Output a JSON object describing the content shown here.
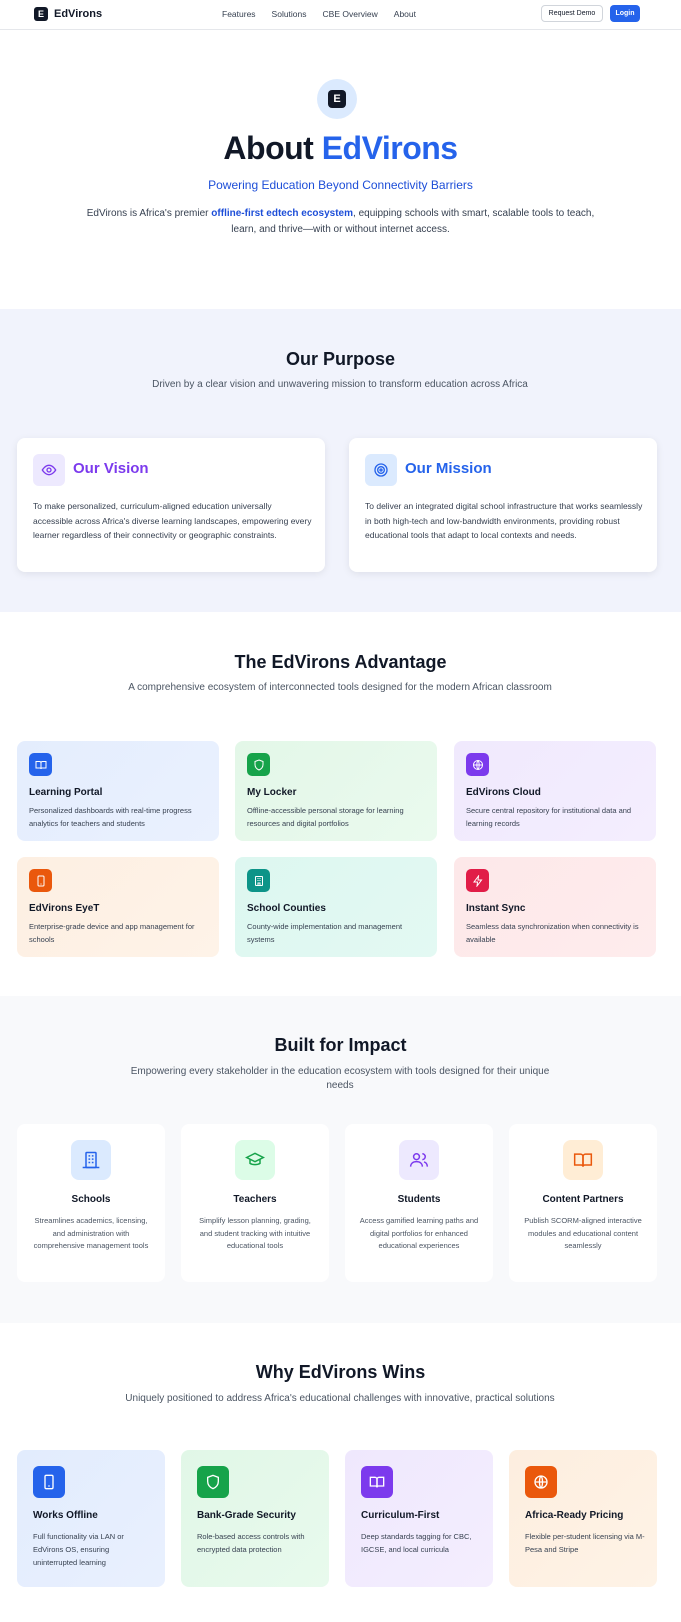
{
  "nav": {
    "brand": "EdVirons",
    "brand_logo_letter": "E",
    "links": [
      "Features",
      "Solutions",
      "CBE Overview",
      "About"
    ],
    "request_demo": "Request Demo",
    "login": "Login",
    "accent_color": "#2563eb"
  },
  "hero": {
    "logo_letter": "E",
    "title_prefix": "About",
    "title_accent": "EdVirons",
    "subtitle": "Powering Education Beyond Connectivity Barriers",
    "desc_before": "EdVirons is Africa's premier",
    "desc_highlight": "offline-first edtech ecosystem",
    "desc_after": ", equipping schools with smart, scalable tools to teach, learn, and thrive—with or without internet access."
  },
  "purpose": {
    "title": "Our Purpose",
    "subtitle": "Driven by a clear vision and unwavering mission to transform education across Africa",
    "vision": {
      "icon": "eye-icon",
      "title": "Our Vision",
      "text": "To make personalized, curriculum-aligned education universally accessible across Africa's diverse learning landscapes, empowering every learner regardless of their connectivity or geographic constraints.",
      "color": "#7c3aed"
    },
    "mission": {
      "icon": "target-icon",
      "title": "Our Mission",
      "text": "To deliver an integrated digital school infrastructure that works seamlessly in both high-tech and low-bandwidth environments, providing robust educational tools that adapt to local contexts and needs.",
      "color": "#2563eb"
    }
  },
  "advantage": {
    "title": "The EdVirons Advantage",
    "subtitle": "A comprehensive ecosystem of interconnected tools designed for the modern African classroom",
    "items": [
      {
        "icon": "book-icon",
        "title": "Learning Portal",
        "text": "Personalized dashboards with real-time progress analytics for teachers and students",
        "color": "#2563eb",
        "bg": "#e6effd"
      },
      {
        "icon": "shield-icon",
        "title": "My Locker",
        "text": "Offline-accessible personal storage for learning resources and digital portfolios",
        "color": "#16a34a",
        "bg": "#e5f8ea"
      },
      {
        "icon": "globe-icon",
        "title": "EdVirons Cloud",
        "text": "Secure central repository for institutional data and learning records",
        "color": "#7c3aed",
        "bg": "#f2ebfd"
      },
      {
        "icon": "tablet-icon",
        "title": "EdVirons EyeT",
        "text": "Enterprise-grade device and app management for schools",
        "color": "#ea580c",
        "bg": "#fdf1e4"
      },
      {
        "icon": "building-icon",
        "title": "School Counties",
        "text": "County-wide implementation and management systems",
        "color": "#0d9488",
        "bg": "#dff8f1"
      },
      {
        "icon": "lightning-icon",
        "title": "Instant Sync",
        "text": "Seamless data synchronization when connectivity is available",
        "color": "#e11d48",
        "bg": "#fde9ea"
      }
    ]
  },
  "impact": {
    "title": "Built for Impact",
    "subtitle": "Empowering every stakeholder in the education ecosystem with tools designed for their unique needs",
    "items": [
      {
        "icon": "school-building-icon",
        "title": "Schools",
        "text": "Streamlines academics, licensing, and administration with comprehensive management tools",
        "color": "#2563eb",
        "bg": "#dbeafe"
      },
      {
        "icon": "graduation-cap-icon",
        "title": "Teachers",
        "text": "Simplify lesson planning, grading, and student tracking with intuitive educational tools",
        "color": "#16a34a",
        "bg": "#dcfce7"
      },
      {
        "icon": "users-icon",
        "title": "Students",
        "text": "Access gamified learning paths and digital portfolios for enhanced educational experiences",
        "color": "#7c3aed",
        "bg": "#ede9fe"
      },
      {
        "icon": "open-book-icon",
        "title": "Content Partners",
        "text": "Publish SCORM-aligned interactive modules and educational content seamlessly",
        "color": "#ea580c",
        "bg": "#ffedd5"
      }
    ]
  },
  "wins": {
    "title": "Why EdVirons Wins",
    "subtitle": "Uniquely positioned to address Africa's educational challenges with innovative, practical solutions",
    "items": [
      {
        "icon": "phone-icon",
        "title": "Works Offline",
        "text": "Full functionality via LAN or EdVirons OS, ensuring uninterrupted learning",
        "color": "#2563eb",
        "bg": "#e5eefd"
      },
      {
        "icon": "shield-icon",
        "title": "Bank-Grade Security",
        "text": "Role-based access controls with encrypted data protection",
        "color": "#16a34a",
        "bg": "#e4f8e9"
      },
      {
        "icon": "open-book-icon",
        "title": "Curriculum-First",
        "text": "Deep standards tagging for CBC, IGCSE, and local curricula",
        "color": "#7c3aed",
        "bg": "#f1eafd"
      },
      {
        "icon": "globe-icon",
        "title": "Africa-Ready Pricing",
        "text": "Flexible per-student licensing via M-Pesa and Stripe",
        "color": "#ea580c",
        "bg": "#fdf0e2"
      }
    ]
  }
}
